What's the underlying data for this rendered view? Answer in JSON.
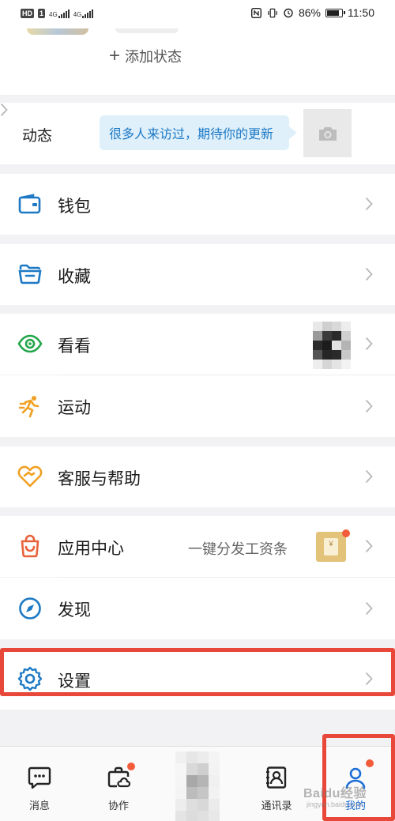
{
  "status_bar": {
    "hd": "HD",
    "sim": "1",
    "net1": "4G",
    "net2": "4G",
    "battery_percent": "86%",
    "battery_level": 0.86,
    "time": "11:50"
  },
  "profile": {
    "add_status_label": "添加状态"
  },
  "dynamics": {
    "label": "动态",
    "bubble_text": "很多人来访过，期待你的更新"
  },
  "menu": {
    "wallet": "钱包",
    "favorites": "收藏",
    "look": "看看",
    "sports": "运动",
    "support": "客服与帮助",
    "app_center": "应用中心",
    "app_center_note": "一键分发工资条",
    "discover": "发现",
    "settings": "设置"
  },
  "tabbar": {
    "messages": "消息",
    "collab": "协作",
    "contacts": "通讯录",
    "me": "我的"
  },
  "watermark": {
    "brand": "Baidu经验",
    "url": "jingyan.baidu.com"
  },
  "colors": {
    "accent_blue": "#1d79c4",
    "highlight_red": "#e8483a",
    "badge_orange": "#f25c3a",
    "icon_green": "#23a64a",
    "icon_orange": "#f0a022",
    "icon_red_orange": "#e8623a"
  }
}
